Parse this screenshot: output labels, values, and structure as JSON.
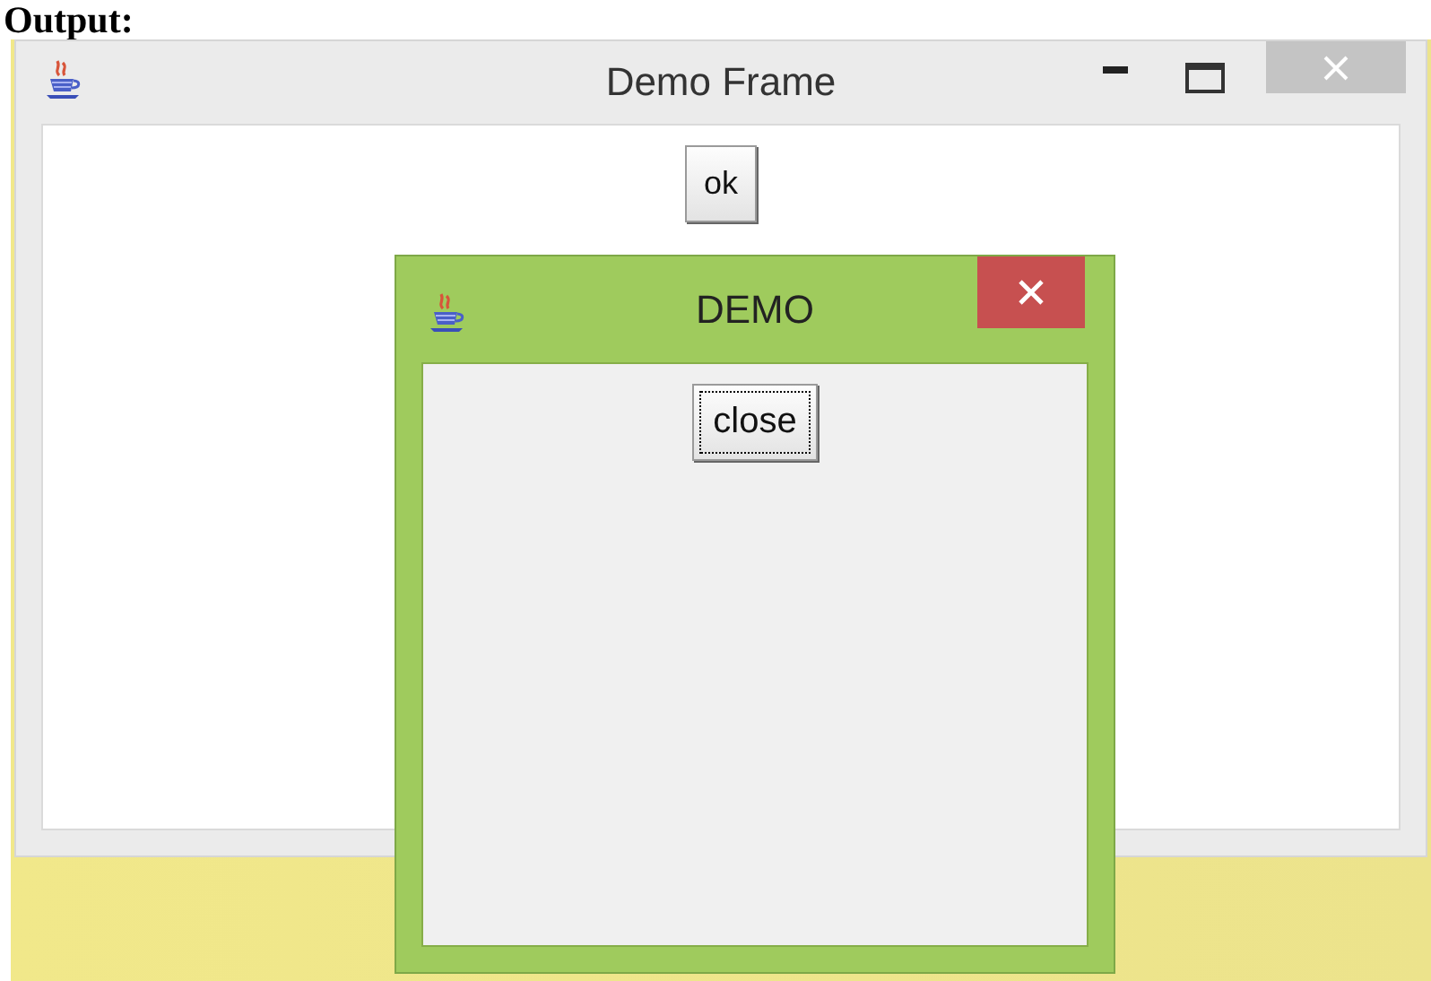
{
  "heading": "Output:",
  "main_window": {
    "title": "Demo Frame",
    "button": "ok"
  },
  "dialog": {
    "title": "DEMO",
    "button": {
      "label": "close",
      "focused": true
    }
  }
}
